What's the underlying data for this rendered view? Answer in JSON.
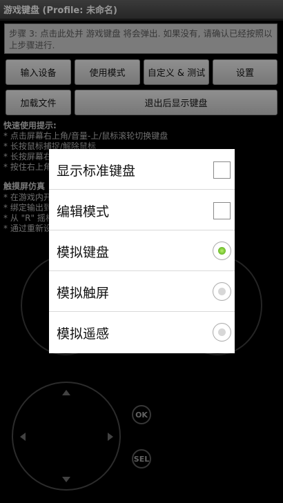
{
  "titlebar": {
    "title": "游戏键盘 (Profile: 未命名)"
  },
  "step_box": {
    "text": "步骤 3: 点击此处并 游戏键盘 将会弹出. 如果没有, 请确认已经按照以上步骤进行."
  },
  "buttons": {
    "input_device": "输入设备",
    "usage_mode": "使用模式",
    "custom_test": "自定义 & 测试",
    "settings": "设置",
    "load_file": "加载文件",
    "show_keyboard_on_exit": "退出后显示键盘"
  },
  "quick_help": {
    "title": "快速使用提示:",
    "lines": [
      "* 点击屏幕右上角/音量-上/鼠标滚轮切换键盘",
      "* 长按鼠标捕捉/解除鼠标",
      "* 长按屏幕右",
      "* 按住右上角"
    ]
  },
  "touch_help": {
    "title": "触摸屏仿真",
    "lines": [
      "* 在游戏内开",
      "* 绑定输出到",
      "* 从 \"R\" 摇杆",
      "* 通过重新设"
    ]
  },
  "gamepad": {
    "ok_label": "OK",
    "sel_label": "SEL"
  },
  "menu": {
    "items": [
      {
        "label": "显示标准键盘",
        "control": "checkbox",
        "checked": false
      },
      {
        "label": "编辑模式",
        "control": "checkbox",
        "checked": false
      },
      {
        "label": "模拟键盘",
        "control": "radio",
        "checked": true
      },
      {
        "label": "模拟触屏",
        "control": "radio",
        "checked": false
      },
      {
        "label": "模拟遥感",
        "control": "radio",
        "checked": false
      }
    ]
  },
  "colors": {
    "radio_selected": "#6cc12a",
    "background": "#000000",
    "button_bg": "#c8c8c8"
  }
}
